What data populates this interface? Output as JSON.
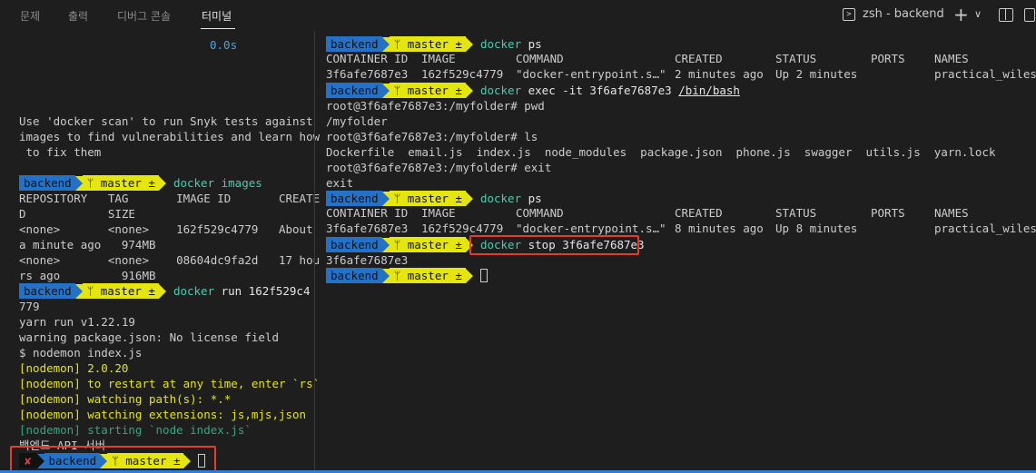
{
  "tabs": [
    {
      "label": "문제"
    },
    {
      "label": "출력"
    },
    {
      "label": "디버그 콘솔"
    },
    {
      "label": "터미널"
    }
  ],
  "terminal_header": {
    "shell_name": "zsh - backend",
    "plus_icon": "+",
    "chevron_icon": "∨",
    "terminal_icon": ">"
  },
  "prompt": {
    "dir": "backend",
    "branch_glyph": "ᛘ",
    "branch": "master ±",
    "error_mark": "✘"
  },
  "left": {
    "time": "0.0s",
    "scan_lines": [
      "Use 'docker scan' to run Snyk tests against",
      "images to find vulnerabilities and learn how",
      " to fix them"
    ],
    "cmd_images": "docker images",
    "images_header_1": "REPOSITORY   TAG       IMAGE ID       CREATE",
    "images_header_2": "D            SIZE",
    "images_rows": [
      "<none>       <none>    162f529c4779   About",
      "a minute ago   974MB",
      "<none>       <none>    08604dc9fa2d   17 hou",
      "rs ago         916MB"
    ],
    "cmd_run": "docker run 162f529c4",
    "cmd_run_cont": "779",
    "yarn_lines": [
      "yarn run v1.22.19",
      "warning package.json: No license field",
      "$ nodemon index.js"
    ],
    "nodemon_lines": [
      "[nodemon] 2.0.20",
      "[nodemon] to restart at any time, enter `rs`",
      "[nodemon] watching path(s): *.*",
      "[nodemon] watching extensions: js,mjs,json"
    ],
    "nodemon_starting": "[nodemon] starting `node index.js`",
    "server_line": "백엔드 API 서버"
  },
  "right": {
    "cmd_ps": "docker ps",
    "ps_headers": [
      "CONTAINER ID",
      "IMAGE",
      "COMMAND",
      "CREATED",
      "STATUS",
      "PORTS",
      "NAMES"
    ],
    "ps_row_1": [
      "3f6afe7687e3",
      "162f529c4779",
      "\"docker-entrypoint.s…\"",
      "2 minutes ago",
      "Up 2 minutes",
      "",
      "practical_wiles"
    ],
    "cmd_exec": "docker exec -it 3f6afe7687e3",
    "cmd_exec_arg": "/bin/bash",
    "shell_lines": [
      "root@3f6afe7687e3:/myfolder# pwd",
      "/myfolder",
      "root@3f6afe7687e3:/myfolder# ls",
      "Dockerfile  email.js  index.js  node_modules  package.json  phone.js  swagger  utils.js  yarn.lock",
      "root@3f6afe7687e3:/myfolder# exit",
      "exit"
    ],
    "cmd_ps2": "docker ps",
    "ps_row_2": [
      "3f6afe7687e3",
      "162f529c4779",
      "\"docker-entrypoint.s…\"",
      "8 minutes ago",
      "Up 8 minutes",
      "",
      "practical_wiles"
    ],
    "cmd_stop": "docker stop 3f6afe7687e3",
    "stop_output": "3f6afe7687e3"
  }
}
